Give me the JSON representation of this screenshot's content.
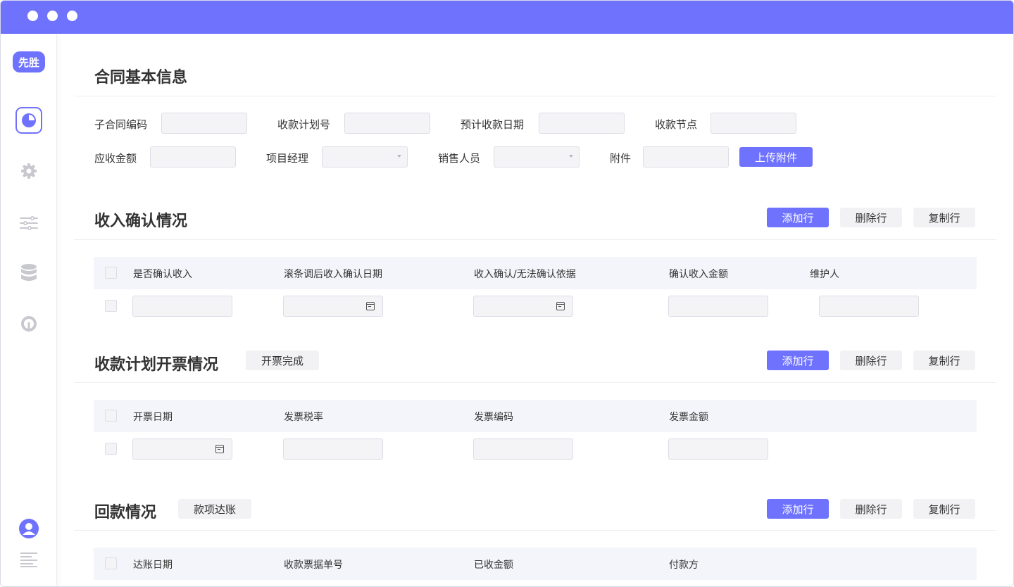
{
  "sidebar": {
    "logo": "先胜",
    "icons": [
      "pie-chart-icon",
      "gear-icon",
      "sliders-icon",
      "database-icon",
      "gauge-icon",
      "user-avatar-icon",
      "text-lines-icon"
    ]
  },
  "section_basic": {
    "title": "合同基本信息",
    "fields": {
      "sub_contract_code": "子合同编码",
      "collection_plan_no": "收款计划号",
      "expected_collection_date": "预计收款日期",
      "collection_node": "收款节点",
      "receivable_amount": "应收金额",
      "project_manager": "项目经理",
      "sales_person": "销售人员",
      "attachment": "附件"
    },
    "upload_button": "上传附件"
  },
  "section_revenue": {
    "title": "收入确认情况",
    "columns": [
      "是否确认收入",
      "滚条调后收入确认日期",
      "收入确认/无法确认依据",
      "确认收入金额",
      "维护人"
    ]
  },
  "section_invoice": {
    "title": "收款计划开票情况",
    "tag": "开票完成",
    "columns": [
      "开票日期",
      "发票税率",
      "发票编码",
      "发票金额"
    ]
  },
  "section_payment": {
    "title": "回款情况",
    "tag": "款项达账",
    "columns": [
      "达账日期",
      "收款票据单号",
      "已收金额",
      "付款方"
    ]
  },
  "actions": {
    "add_row": "添加行",
    "delete_row": "删除行",
    "copy_row": "复制行"
  },
  "colors": {
    "accent": "#6e72fd",
    "input_bg": "#f4f4f7",
    "table_header_bg": "#f4f5fb"
  }
}
